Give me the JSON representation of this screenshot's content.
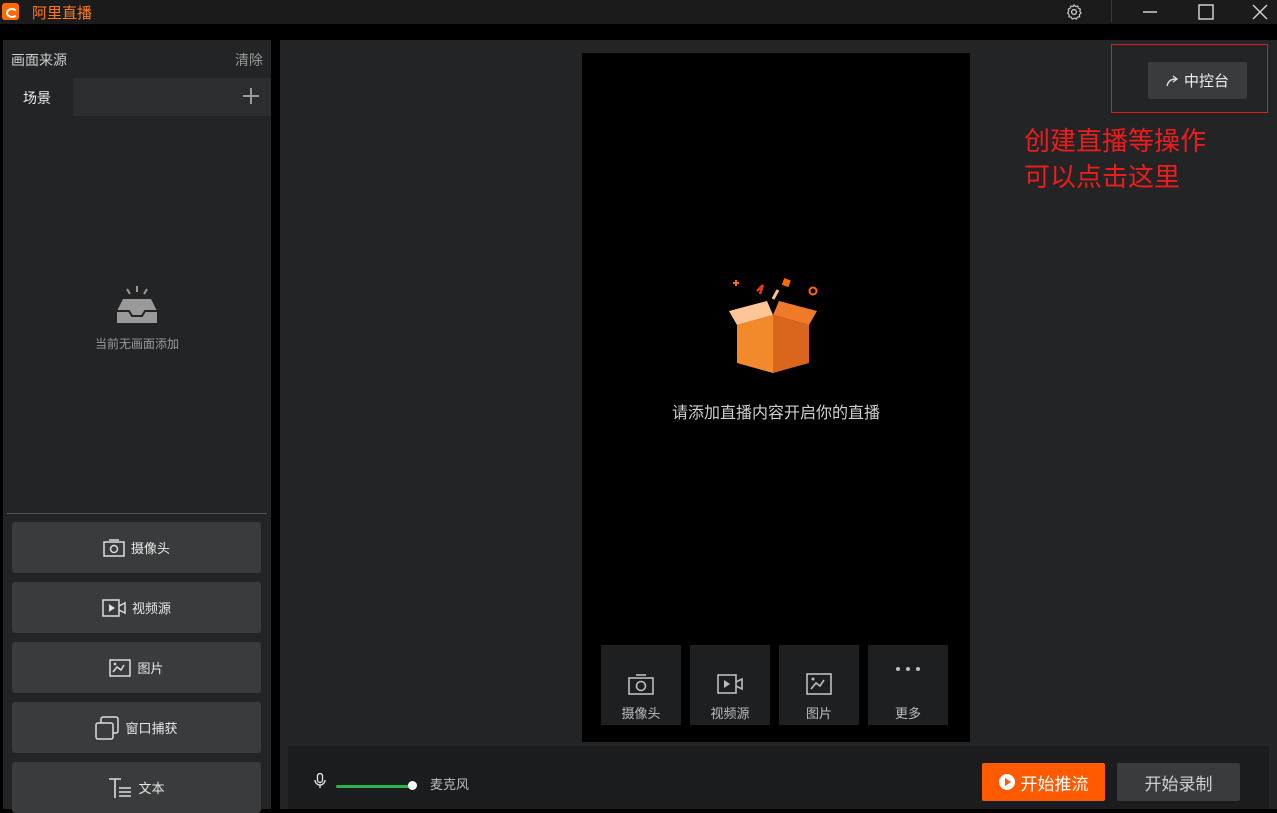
{
  "window": {
    "title": "阿里直播"
  },
  "left_panel": {
    "title": "画面来源",
    "clear_label": "清除",
    "scene_tab_label": "场景",
    "empty_text": "当前无画面添加",
    "source_buttons": [
      {
        "label": "摄像头",
        "icon": "camera-icon"
      },
      {
        "label": "视频源",
        "icon": "video-source-icon"
      },
      {
        "label": "图片",
        "icon": "image-icon"
      },
      {
        "label": "窗口捕获",
        "icon": "window-capture-icon"
      },
      {
        "label": "文本",
        "icon": "text-icon"
      }
    ]
  },
  "preview": {
    "empty_message": "请添加直播内容开启你的直播",
    "add_buttons": [
      {
        "label": "摄像头",
        "icon": "camera-icon"
      },
      {
        "label": "视频源",
        "icon": "video-source-icon"
      },
      {
        "label": "图片",
        "icon": "image-icon"
      },
      {
        "label": "更多",
        "icon": "more-icon"
      }
    ]
  },
  "control_center": {
    "label": "中控台"
  },
  "annotation": {
    "line1": "创建直播等操作",
    "line2": "可以点击这里",
    "color": "#e31b1b"
  },
  "bottom_bar": {
    "mic_label": "麦克风",
    "mic_level": 1.0,
    "start_push_label": "开始推流",
    "start_record_label": "开始录制"
  },
  "colors": {
    "accent": "#ff5a00",
    "mic_level": "#2db14d",
    "title_text": "#ff7a1a"
  }
}
